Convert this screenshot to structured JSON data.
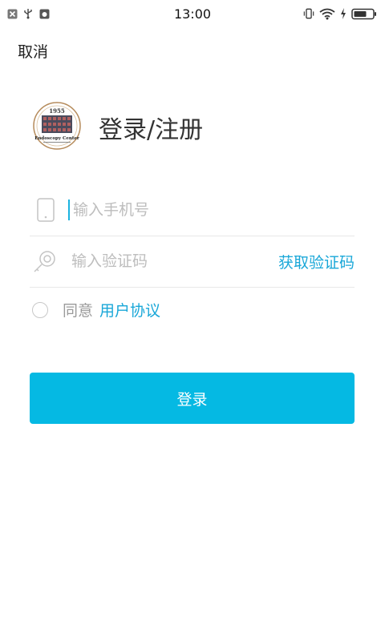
{
  "status_bar": {
    "time": "13:00",
    "left_icons": [
      "close-box-icon",
      "usb-icon",
      "android-debug-icon"
    ],
    "right_icons": [
      "vibrate-icon",
      "wifi-icon",
      "charging-icon",
      "battery-icon"
    ]
  },
  "header": {
    "cancel_label": "取消"
  },
  "brand": {
    "title": "登录/注册",
    "logo_alt": "Endoscopy Center"
  },
  "form": {
    "phone_placeholder": "输入手机号",
    "code_placeholder": "输入验证码",
    "get_code_label": "获取验证码",
    "agree_text": "同意",
    "agreement_link": "用户协议",
    "submit_label": "登录"
  },
  "colors": {
    "accent": "#05b9e3",
    "link": "#19a7d8"
  }
}
